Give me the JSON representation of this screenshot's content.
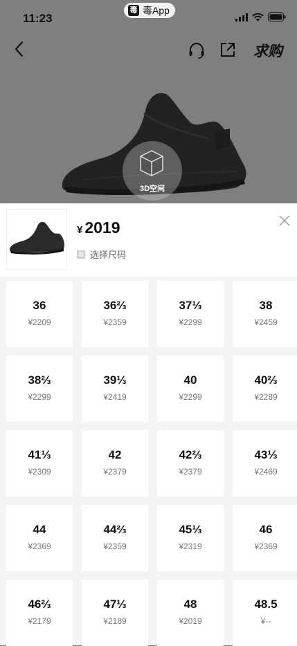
{
  "status_bar": {
    "time": "11:23",
    "app_label": "毒App",
    "app_logo": "毒"
  },
  "nav": {
    "want_label": "求购"
  },
  "hero": {
    "btn_3d_label": "3D空间"
  },
  "sheet": {
    "currency": "¥",
    "price": "2019",
    "select_label": "选择尺码",
    "select_icon": "毒",
    "sizes": [
      {
        "size": "36",
        "price": "¥2209"
      },
      {
        "size": "36⅔",
        "price": "¥2359"
      },
      {
        "size": "37⅓",
        "price": "¥2299"
      },
      {
        "size": "38",
        "price": "¥2459"
      },
      {
        "size": "38⅔",
        "price": "¥2299"
      },
      {
        "size": "39⅓",
        "price": "¥2419"
      },
      {
        "size": "40",
        "price": "¥2299"
      },
      {
        "size": "40⅔",
        "price": "¥2289"
      },
      {
        "size": "41⅓",
        "price": "¥2309"
      },
      {
        "size": "42",
        "price": "¥2379"
      },
      {
        "size": "42⅔",
        "price": "¥2379"
      },
      {
        "size": "43⅓",
        "price": "¥2469"
      },
      {
        "size": "44",
        "price": "¥2369"
      },
      {
        "size": "44⅔",
        "price": "¥2359"
      },
      {
        "size": "45⅓",
        "price": "¥2319"
      },
      {
        "size": "46",
        "price": "¥2369"
      },
      {
        "size": "46⅔",
        "price": "¥2179"
      },
      {
        "size": "47⅓",
        "price": "¥2189"
      },
      {
        "size": "48",
        "price": "¥2019"
      },
      {
        "size": "48.5",
        "price": "¥--"
      }
    ]
  }
}
